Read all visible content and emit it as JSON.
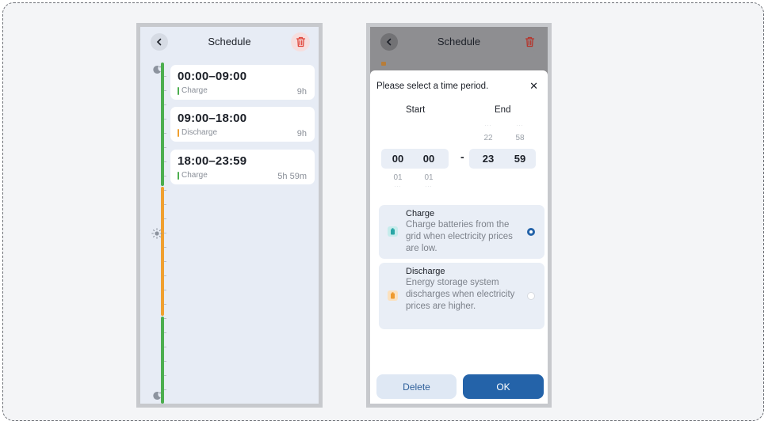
{
  "left_screen": {
    "header": {
      "title": "Schedule",
      "back_icon": "chevron-left-icon",
      "delete_icon": "trash-icon"
    },
    "timeline_icons": [
      "moon-icon",
      "sun-icon",
      "moon-icon"
    ],
    "schedule_items": [
      {
        "time": "00:00–09:00",
        "mode": "Charge",
        "duration": "9h"
      },
      {
        "time": "09:00–18:00",
        "mode": "Discharge",
        "duration": "9h"
      },
      {
        "time": "18:00–23:59",
        "mode": "Charge",
        "duration": "5h 59m"
      }
    ]
  },
  "right_screen": {
    "header": {
      "title": "Schedule"
    },
    "dialog": {
      "prompt": "Please select a time period.",
      "start_label": "Start",
      "end_label": "End",
      "start": {
        "hour": "00",
        "minute": "00",
        "next_hour": "01",
        "next_minute": "01",
        "after_hour": "···",
        "after_minute": "···"
      },
      "separator": "-",
      "end": {
        "hour": "23",
        "minute": "59",
        "prev_hour": "22",
        "prev_minute": "58",
        "before_hour": "···",
        "before_minute": "···"
      },
      "options": [
        {
          "title": "Charge",
          "description": "Charge batteries from the grid when electricity prices are low.",
          "selected": true
        },
        {
          "title": "Discharge",
          "description": "Energy storage system discharges when electricity prices are higher.",
          "selected": false
        }
      ],
      "delete_label": "Delete",
      "ok_label": "OK"
    }
  },
  "colors": {
    "charge": "#4cae4f",
    "discharge": "#f0a030",
    "accent": "#2463a9",
    "danger": "#e0453a"
  }
}
